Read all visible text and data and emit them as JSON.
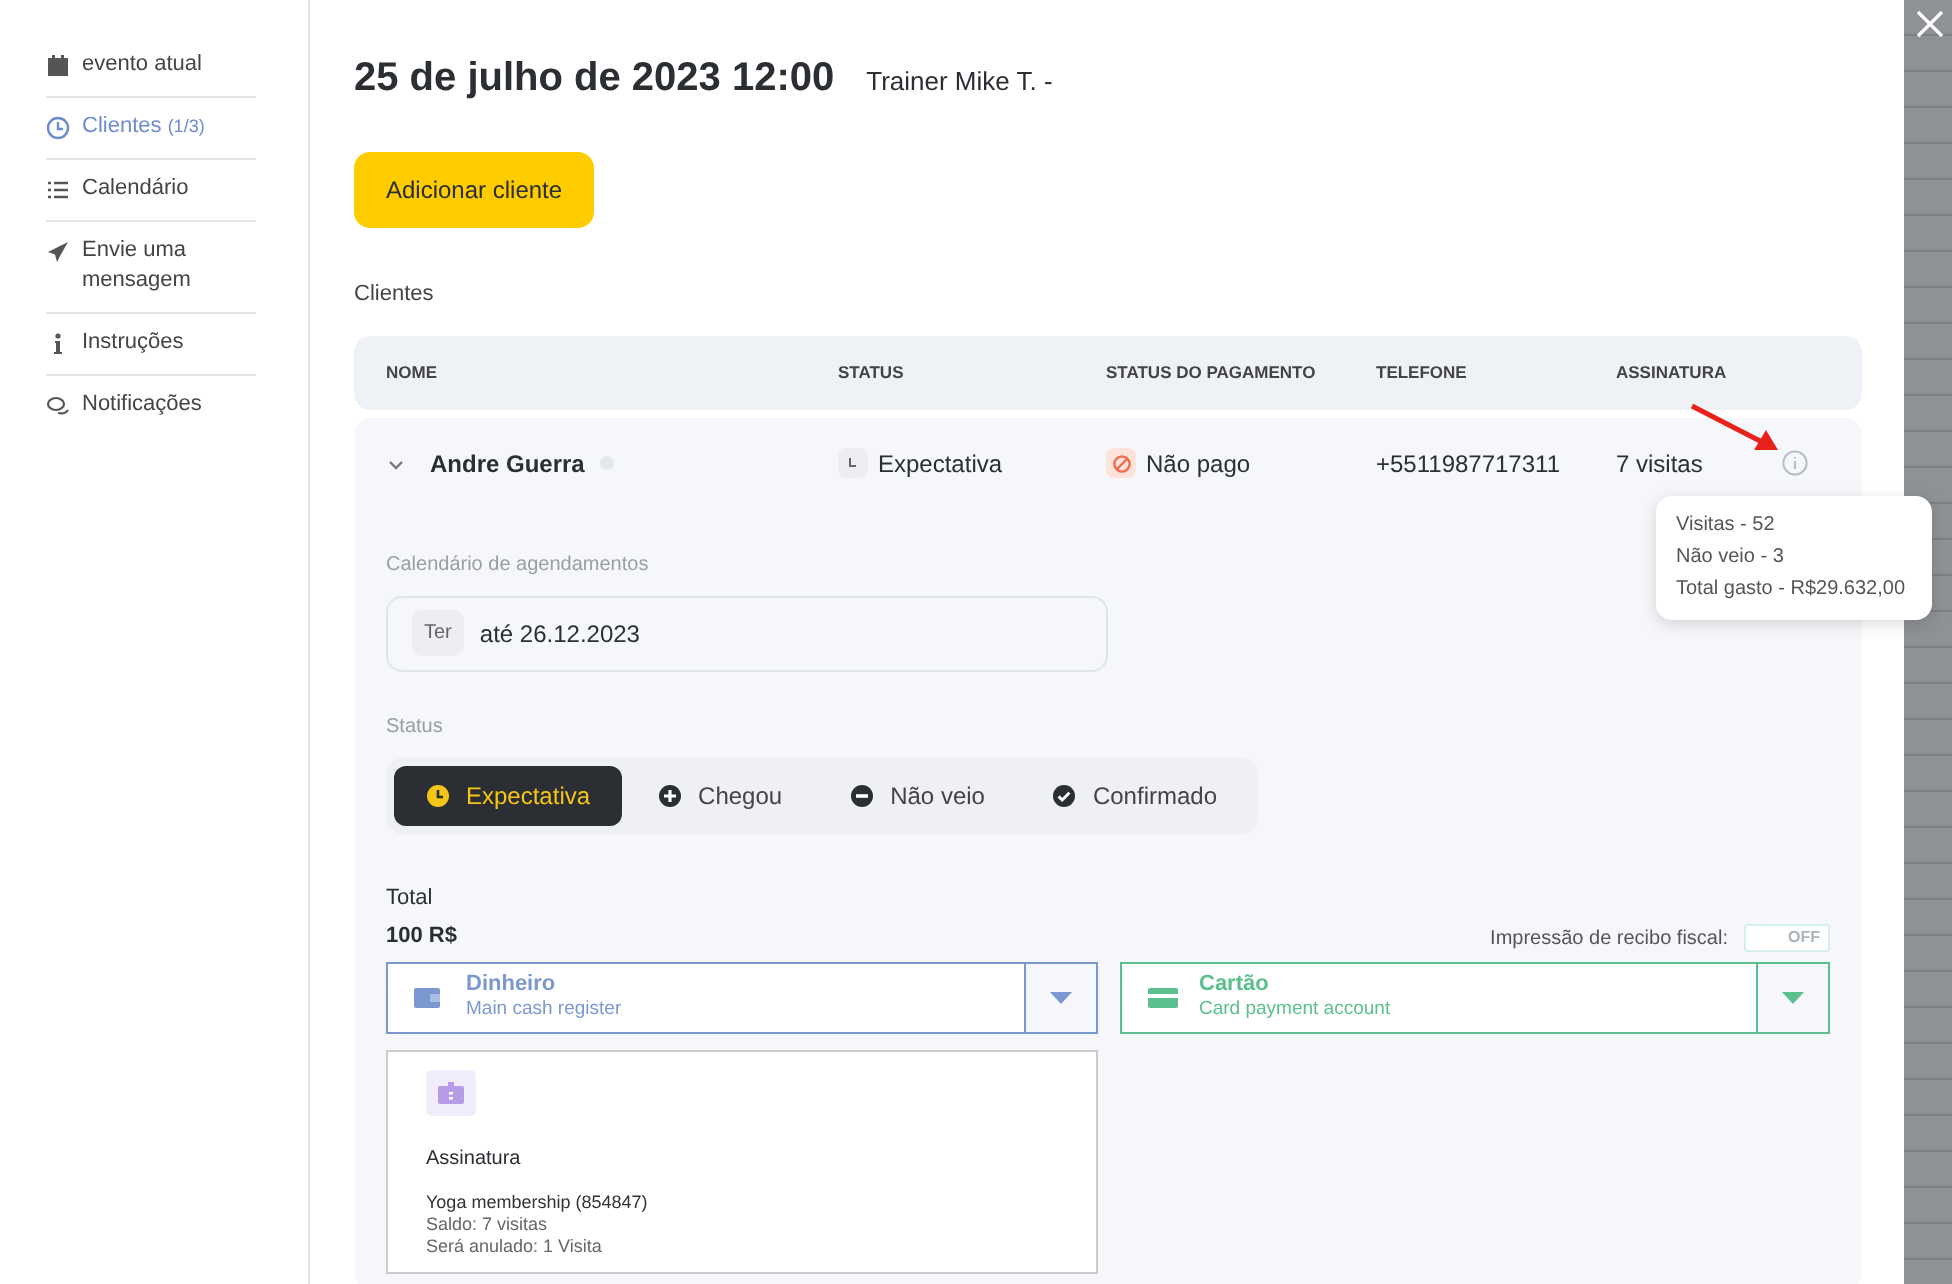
{
  "sidebar": {
    "items": [
      {
        "label": "evento atual",
        "selected": false
      },
      {
        "label": "Clientes",
        "count": "(1/3)",
        "selected": true
      },
      {
        "label": "Calendário",
        "selected": false
      },
      {
        "label": "Envie uma mensagem",
        "selected": false
      },
      {
        "label": "Instruções",
        "selected": false
      },
      {
        "label": "Notificações",
        "selected": false
      }
    ]
  },
  "header": {
    "title": "25 de julho de 2023 12:00",
    "trainer": "Trainer Mike T. -"
  },
  "add_button": "Adicionar cliente",
  "section_label": "Clientes",
  "table": {
    "columns": [
      "NOME",
      "STATUS",
      "STATUS DO PAGAMENTO",
      "TELEFONE",
      "ASSINATURA"
    ],
    "rows": [
      {
        "expanded": true,
        "name": "Andre Guerra",
        "status": "Expectativa",
        "payment_status": "Não pago",
        "phone": "+5511987717311",
        "subscription": "7 visitas"
      }
    ]
  },
  "tooltip": {
    "lines": [
      "Visitas - 52",
      "Não veio - 3",
      "Total gasto - R$29.632,00"
    ]
  },
  "details": {
    "schedule_label": "Calendário de agendamentos",
    "schedule": {
      "day": "Ter",
      "until": "até 26.12.2023"
    },
    "status_label": "Status",
    "status_options": [
      {
        "label": "Expectativa",
        "selected": true
      },
      {
        "label": "Chegou",
        "selected": false
      },
      {
        "label": "Não veio",
        "selected": false
      },
      {
        "label": "Confirmado",
        "selected": false
      }
    ],
    "total_label": "Total",
    "total": "100 R$",
    "receipt": {
      "label": "Impressão de recibo fiscal:",
      "toggle": "OFF",
      "on": false
    },
    "payment_methods": [
      {
        "name": "Dinheiro",
        "account": "Main cash register",
        "color": "#7b98d0"
      },
      {
        "name": "Cartão",
        "account": "Card payment account",
        "color": "#5cc08e"
      }
    ],
    "subscription_card": {
      "title": "Assinatura",
      "lines": [
        "Yoga membership (854847)",
        "Saldo: 7 visitas",
        "Será anulado: 1 Visita"
      ]
    }
  }
}
